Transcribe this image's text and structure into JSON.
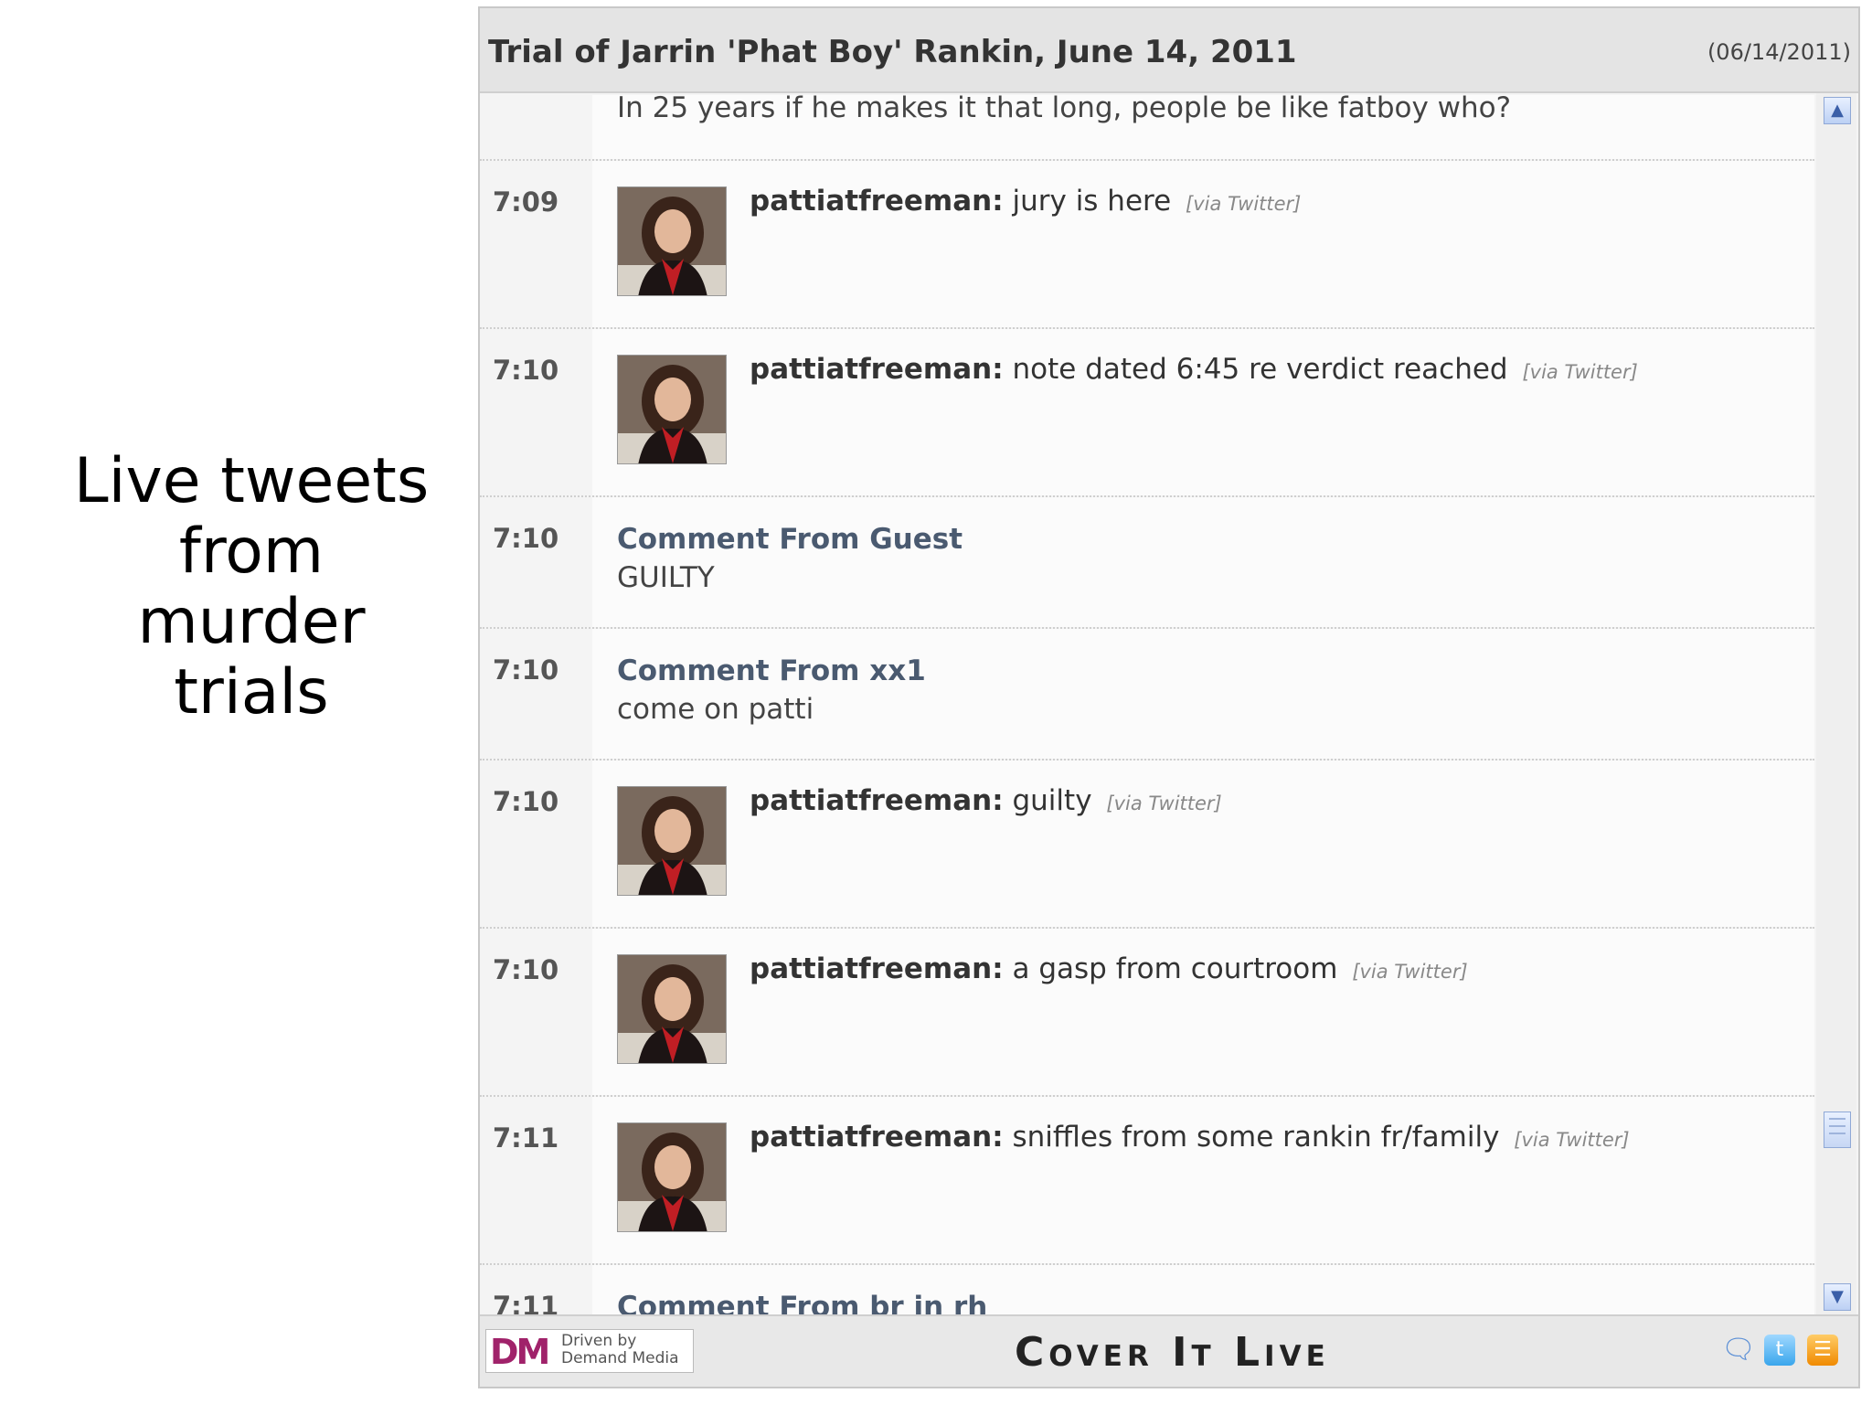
{
  "caption": {
    "lines": [
      "Live tweets",
      "from",
      "murder",
      "trials"
    ]
  },
  "widget": {
    "title": "Trial of Jarrin 'Phat Boy' Rankin, June 14, 2011",
    "date": "(06/14/2011)",
    "partial_top_text": "In 25 years if he makes it that long, people be like fatboy who?",
    "entries": [
      {
        "time": "7:09",
        "type": "tweet",
        "author": "pattiatfreeman:",
        "text": "jury is here",
        "via": "[via Twitter]"
      },
      {
        "time": "7:10",
        "type": "tweet",
        "author": "pattiatfreeman:",
        "text": "note dated 6:45 re verdict reached",
        "via": "[via Twitter]"
      },
      {
        "time": "7:10",
        "type": "comment",
        "heading": "Comment From Guest",
        "text": "GUILTY"
      },
      {
        "time": "7:10",
        "type": "comment",
        "heading": "Comment From xx1",
        "text": "come on patti"
      },
      {
        "time": "7:10",
        "type": "tweet",
        "author": "pattiatfreeman:",
        "text": "guilty",
        "via": "[via Twitter]"
      },
      {
        "time": "7:10",
        "type": "tweet",
        "author": "pattiatfreeman:",
        "text": "a gasp from courtroom",
        "via": "[via Twitter]"
      },
      {
        "time": "7:11",
        "type": "tweet",
        "author": "pattiatfreeman:",
        "text": "sniffles from some rankin fr/family",
        "via": "[via Twitter]"
      },
      {
        "time": "7:11",
        "type": "comment",
        "heading": "Comment From br in rh",
        "text": ""
      }
    ],
    "footer": {
      "dm_logo_mark": "DM",
      "dm_logo_line1": "Driven by",
      "dm_logo_line2": "Demand Media",
      "brand": "Cover It Live",
      "icons": [
        "chat-icon",
        "twitter-icon",
        "rss-icon"
      ]
    }
  }
}
